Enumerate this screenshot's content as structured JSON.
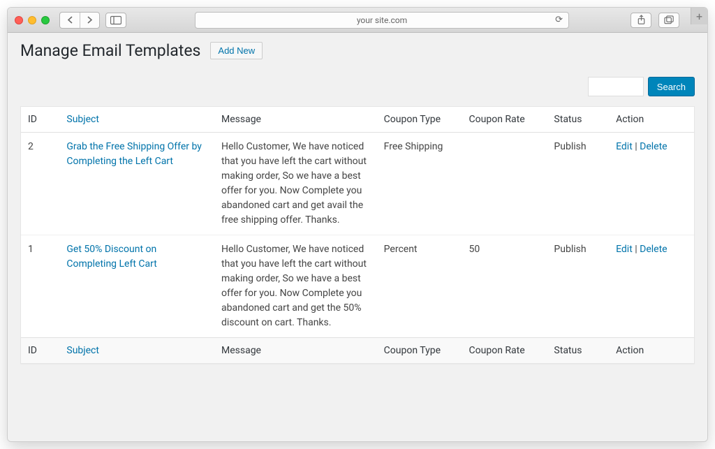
{
  "browser": {
    "url": "your site.com"
  },
  "page": {
    "title": "Manage Email Templates",
    "add_new_label": "Add New",
    "search_label": "Search"
  },
  "columns": {
    "id": "ID",
    "subject": "Subject",
    "message": "Message",
    "coupon_type": "Coupon Type",
    "coupon_rate": "Coupon Rate",
    "status": "Status",
    "action": "Action"
  },
  "actions": {
    "edit": "Edit",
    "delete": "Delete",
    "sep": " | "
  },
  "rows": [
    {
      "id": "2",
      "subject": "Grab the Free Shipping Offer by Completing the Left Cart",
      "message": "Hello Customer, We have noticed that you have left the cart without making order, So we have a best offer for you. Now Complete you abandoned cart and get avail the free shipping offer. Thanks.",
      "coupon_type": "Free Shipping",
      "coupon_rate": "",
      "status": "Publish"
    },
    {
      "id": "1",
      "subject": "Get 50% Discount on Completing Left Cart",
      "message": "Hello Customer, We have noticed that you have left the cart without making order, So we have a best offer for you. Now Complete you abandoned cart and get the 50% discount on cart. Thanks.",
      "coupon_type": "Percent",
      "coupon_rate": "50",
      "status": "Publish"
    }
  ]
}
